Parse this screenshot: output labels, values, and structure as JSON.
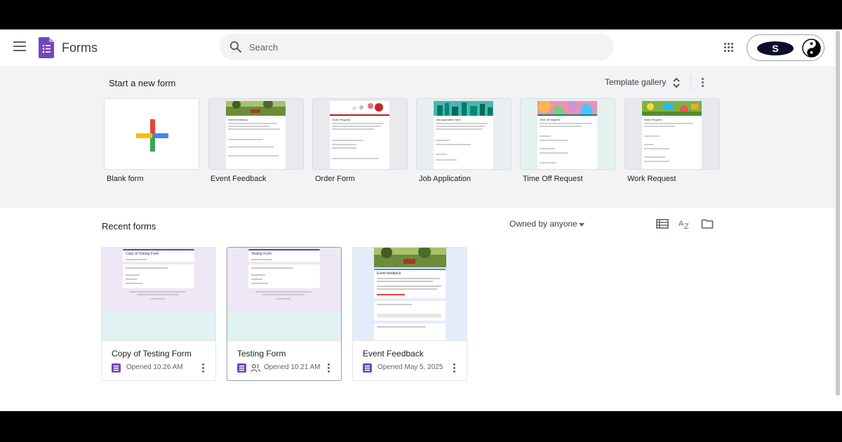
{
  "header": {
    "app_title": "Forms",
    "search_placeholder": "Search"
  },
  "templates": {
    "section_title": "Start a new form",
    "gallery_label": "Template gallery",
    "items": [
      {
        "label": "Blank form"
      },
      {
        "label": "Event Feedback",
        "preview_title": "Event feedback"
      },
      {
        "label": "Order Form",
        "preview_title": "Order Request"
      },
      {
        "label": "Job Application",
        "preview_title": "Job application form"
      },
      {
        "label": "Time Off Request",
        "preview_title": "Time off request"
      },
      {
        "label": "Work Request",
        "preview_title": "Work Request"
      }
    ]
  },
  "recent": {
    "section_title": "Recent forms",
    "owner_filter": "Owned by anyone",
    "forms": [
      {
        "name": "Copy of Testing Form",
        "opened": "Opened 10:26 AM",
        "shared": false,
        "preview_title": "Copy of Testing Form"
      },
      {
        "name": "Testing Form",
        "opened": "Opened 10:21 AM",
        "shared": true,
        "preview_title": "Testing Form"
      },
      {
        "name": "Event Feedback",
        "opened": "Opened May 5, 2025",
        "shared": false,
        "preview_title": "Event feedback"
      }
    ]
  },
  "colors": {
    "forms_purple": "#7248b9",
    "template_band": "#f1f3f4",
    "google_blue": "#4285f4",
    "google_red": "#ea4335",
    "google_yellow": "#fbbc04",
    "google_green": "#34a853"
  }
}
